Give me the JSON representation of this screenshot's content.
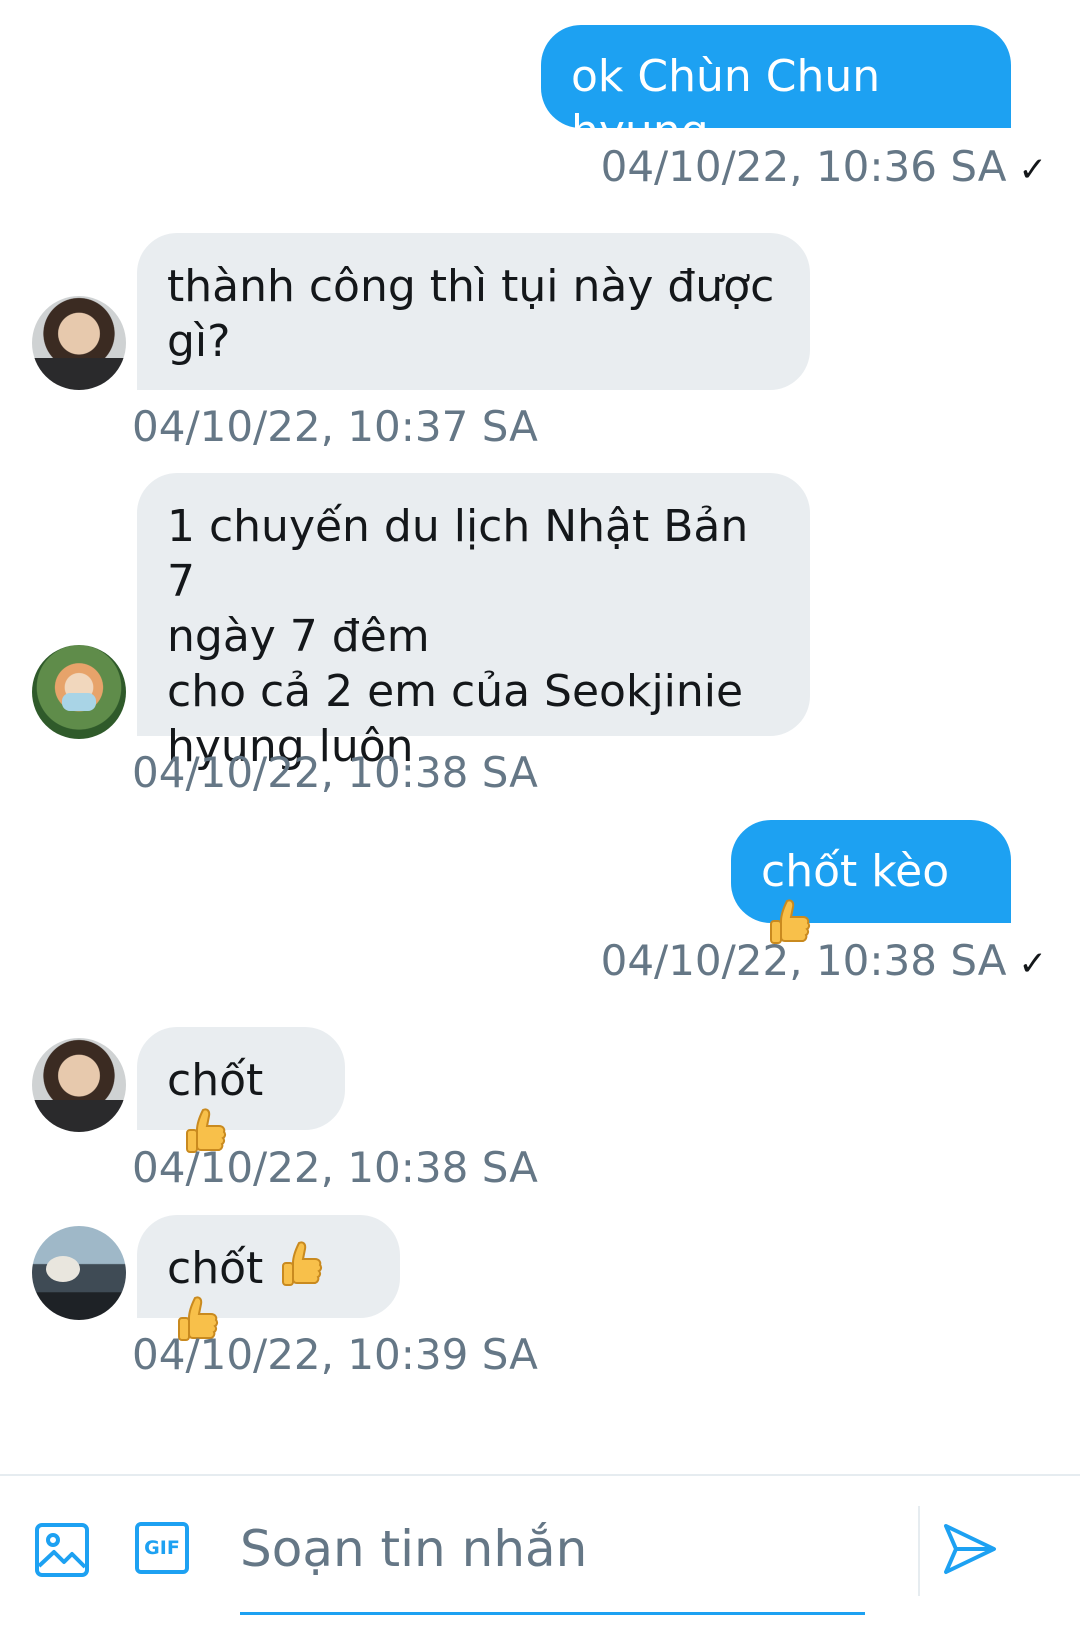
{
  "messages": [
    {
      "text": "ok Chùn Chun hyung",
      "time": "04/10/22, 10:36 SA"
    },
    {
      "lines": [
        "thành công thì tụi này được",
        "gì?"
      ],
      "time": "04/10/22, 10:37 SA"
    },
    {
      "lines": [
        "1 chuyến du lịch Nhật Bản 7",
        "ngày 7 đêm",
        "cho cả 2 em của Seokjinie",
        "hyung luôn"
      ],
      "time": "04/10/22, 10:38 SA"
    },
    {
      "text": "chốt kèo",
      "time": "04/10/22, 10:38 SA"
    },
    {
      "text": "chốt",
      "time": "04/10/22, 10:38 SA"
    },
    {
      "text": "chốt",
      "time": "04/10/22, 10:39 SA"
    }
  ],
  "read_receipt": "✓",
  "composer": {
    "placeholder": "Soạn tin nhắn",
    "gif_label": "GIF"
  },
  "icons": {
    "image": "image-icon",
    "gif": "gif-icon",
    "send": "send-icon",
    "reaction": "thumbs-up-emoji"
  },
  "colors": {
    "accent": "#1da1f2",
    "incoming_bubble": "#e9edf0",
    "timestamp": "#657786"
  }
}
